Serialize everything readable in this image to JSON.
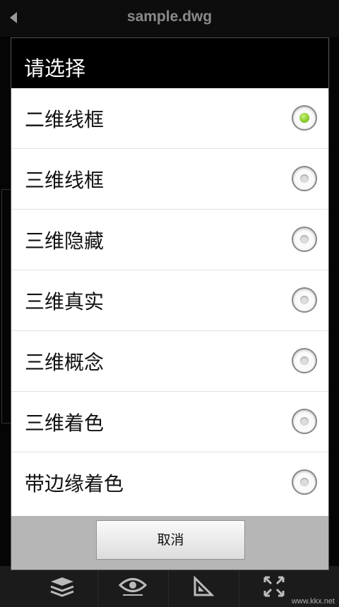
{
  "app": {
    "file_title": "sample.dwg",
    "watermark": "www.kkx.net"
  },
  "dialog": {
    "title": "请选择",
    "options": [
      {
        "label": "二维线框",
        "selected": true
      },
      {
        "label": "三维线框",
        "selected": false
      },
      {
        "label": "三维隐藏",
        "selected": false
      },
      {
        "label": "三维真实",
        "selected": false
      },
      {
        "label": "三维概念",
        "selected": false
      },
      {
        "label": "三维着色",
        "selected": false
      },
      {
        "label": "带边缘着色",
        "selected": false
      }
    ],
    "cancel_label": "取消"
  },
  "toolbar": {
    "icons": [
      "layers-icon",
      "eye-icon",
      "ruler-icon",
      "fullscreen-icon"
    ]
  },
  "colors": {
    "accent": "#7ec31e",
    "dialog_title_bg": "#000000",
    "footer_bg": "#b6b6b6"
  }
}
